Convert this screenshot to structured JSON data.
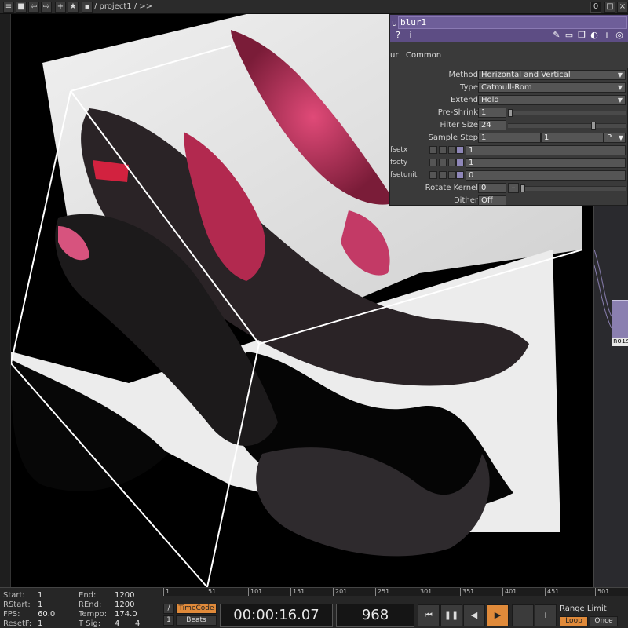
{
  "toolbar": {
    "path": "/ project1 / >>",
    "count": "0"
  },
  "panel": {
    "op_type": "ur",
    "op_name": "blur1",
    "tabs": [
      "ur",
      "Common"
    ],
    "params": {
      "method": {
        "label": "Method",
        "value": "Horizontal and Vertical"
      },
      "type": {
        "label": "Type",
        "value": "Catmull-Rom"
      },
      "extend": {
        "label": "Extend",
        "value": "Hold"
      },
      "preshrink": {
        "label": "Pre-Shrink",
        "value": "1"
      },
      "filtersize": {
        "label": "Filter Size",
        "value": "24"
      },
      "samplestep": {
        "label": "Sample Step",
        "value1": "1",
        "value2": "1",
        "unit": "P"
      },
      "offsetx": {
        "label": "fsetx",
        "value": "1"
      },
      "offsety": {
        "label": "fsety",
        "value": "1"
      },
      "offsetunit": {
        "label": "fsetunit",
        "value": "0"
      },
      "rotatekernel": {
        "label": "Rotate Kernel",
        "value": "0"
      },
      "dither": {
        "label": "Dither",
        "value": "Off"
      }
    }
  },
  "network": {
    "node_label": "nois"
  },
  "timeline": {
    "start_label": "Start:",
    "start": "1",
    "end_label": "End:",
    "end": "1200",
    "rstart_label": "RStart:",
    "rstart": "1",
    "rend_label": "REnd:",
    "rend": "1200",
    "fps_label": "FPS:",
    "fps": "60.0",
    "tempo_label": "Tempo:",
    "tempo": "174.0",
    "resetf_label": "ResetF:",
    "resetf": "1",
    "tsig_label": "T Sig:",
    "tsig1": "4",
    "tsig2": "4",
    "ruler_ticks": [
      "1",
      "51",
      "101",
      "151",
      "201",
      "251",
      "301",
      "351",
      "401",
      "451",
      "501"
    ],
    "timecode_button": "TimeCode",
    "beats_button": "Beats",
    "timecode": "00:00:16.07",
    "frame": "968",
    "range_limit_label": "Range Limit",
    "loop_button": "Loop",
    "once_button": "Once",
    "mini_left_1": "/",
    "mini_left_2": "1"
  },
  "colors": {
    "op_header": "#5d4d84",
    "accent_orange": "#e08a3a",
    "node_purple": "#8a7fb0",
    "fractal_pink": "#c8325a"
  }
}
